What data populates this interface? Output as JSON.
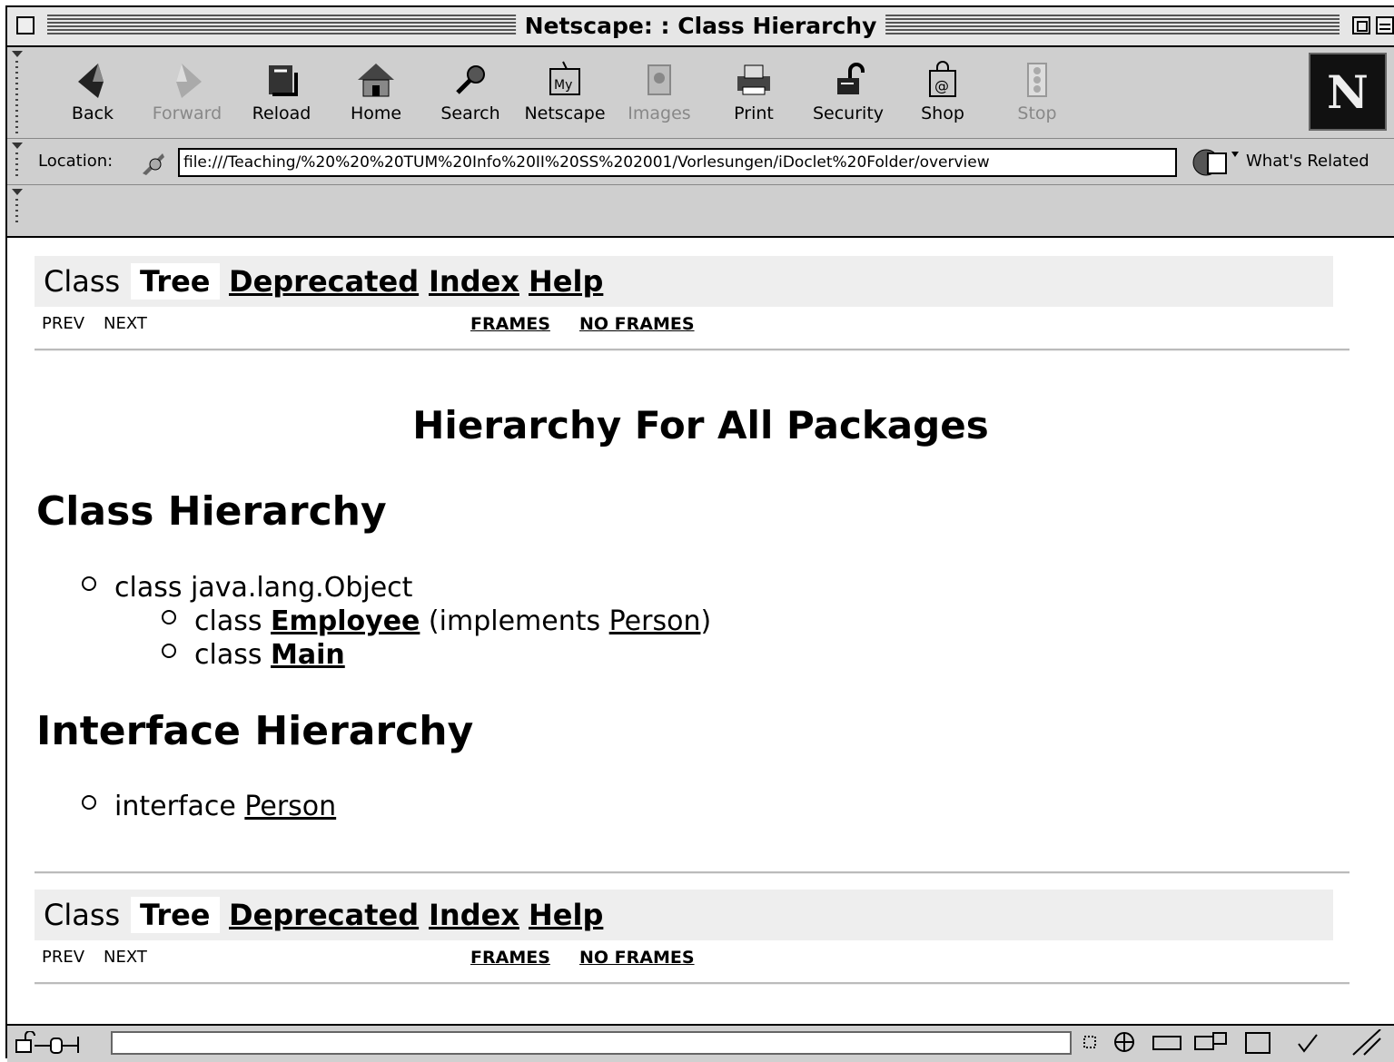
{
  "window": {
    "title": "Netscape: : Class Hierarchy"
  },
  "toolbar": {
    "buttons": [
      {
        "label": "Back",
        "icon": "back-icon",
        "enabled": true
      },
      {
        "label": "Forward",
        "icon": "forward-icon",
        "enabled": false
      },
      {
        "label": "Reload",
        "icon": "reload-icon",
        "enabled": true
      },
      {
        "label": "Home",
        "icon": "home-icon",
        "enabled": true
      },
      {
        "label": "Search",
        "icon": "search-icon",
        "enabled": true
      },
      {
        "label": "Netscape",
        "icon": "my-netscape-icon",
        "enabled": true
      },
      {
        "label": "Images",
        "icon": "images-icon",
        "enabled": false
      },
      {
        "label": "Print",
        "icon": "print-icon",
        "enabled": true
      },
      {
        "label": "Security",
        "icon": "security-icon",
        "enabled": true
      },
      {
        "label": "Shop",
        "icon": "shop-icon",
        "enabled": true
      },
      {
        "label": "Stop",
        "icon": "stop-icon",
        "enabled": false
      }
    ],
    "logo_letter": "N"
  },
  "location": {
    "label": "Location:",
    "url": "file:///Teaching/%20%20%20TUM%20Info%20II%20SS%202001/Vorlesungen/iDoclet%20Folder/overview",
    "related_label": "What's Related"
  },
  "nav": {
    "class": "Class",
    "tree": "Tree",
    "deprecated": "Deprecated",
    "index": "Index",
    "help": "Help",
    "prev": "PREV",
    "next": "NEXT",
    "frames": "FRAMES",
    "no_frames": "NO FRAMES"
  },
  "page": {
    "title": "Hierarchy For All Packages",
    "class_heading": "Class Hierarchy",
    "interface_heading": "Interface Hierarchy",
    "root": {
      "prefix": "class ",
      "name": "java.lang.Object"
    },
    "employee": {
      "prefix": "class ",
      "name": "Employee",
      "impl_open": " (implements ",
      "iface": "Person",
      "impl_close": ")"
    },
    "main": {
      "prefix": "class ",
      "name": "Main"
    },
    "interface": {
      "prefix": "interface ",
      "name": "Person"
    }
  }
}
